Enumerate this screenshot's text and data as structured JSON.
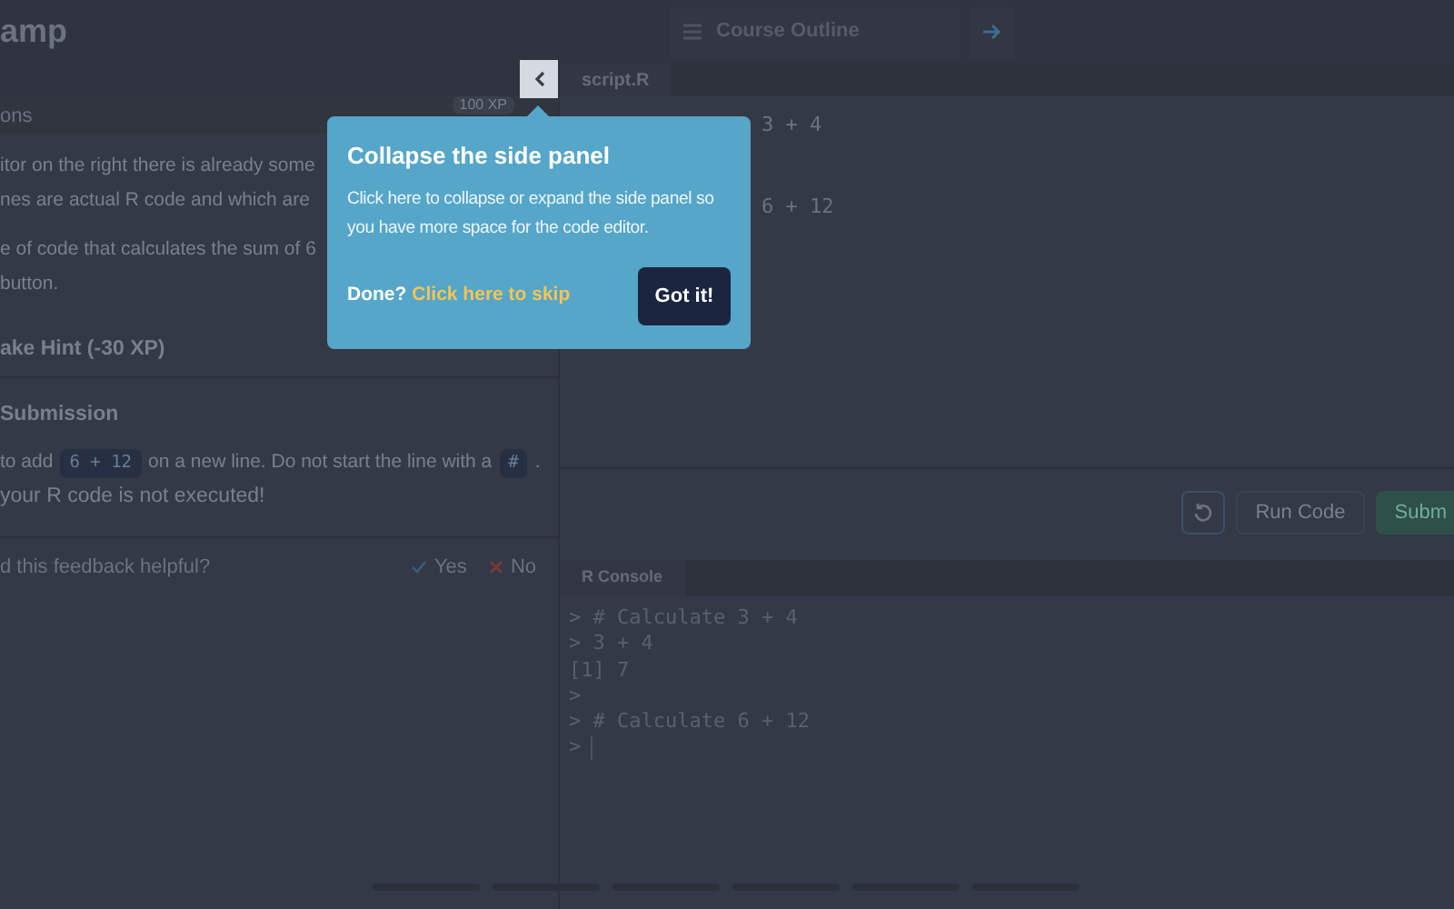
{
  "header": {
    "title": "amp",
    "course_outline": "Course Outline"
  },
  "exercise": {
    "tab": "ons",
    "xp": "100 XP",
    "paragraphs": [
      [
        "itor on the right there is already some",
        "nes are actual R code and which are"
      ],
      [
        "e of code that calculates the sum of 6",
        "button."
      ]
    ],
    "hint": "ake Hint (-30 XP)",
    "feedback": {
      "title": "Submission",
      "segments": [
        {
          "kind": "text",
          "text": "to add"
        },
        {
          "kind": "code",
          "text": "6 + 12"
        },
        {
          "kind": "text",
          "text": "on a new line. Do not start the line with a"
        },
        {
          "kind": "code",
          "text": "#"
        },
        {
          "kind": "text",
          "text": "."
        }
      ],
      "last_line": "your R code is not executed!"
    },
    "helpful": {
      "question": "d this feedback helpful?",
      "yes": "Yes",
      "no": "No"
    }
  },
  "editor": {
    "tab": "script.R",
    "lines": [
      "3 + 4",
      "6 + 12"
    ],
    "run": "Run Code",
    "submit": "Subm"
  },
  "console": {
    "tab": "R Console",
    "lines": [
      "> # Calculate 3 + 4",
      "> 3 + 4",
      "[1] 7",
      ">",
      "> # Calculate 6 + 12",
      ">"
    ]
  },
  "popup": {
    "title": "Collapse the side panel",
    "body": "Click here to collapse or expand the side panel so you have more space for the code editor.",
    "done": "Done?",
    "skip": "Click here to skip",
    "button": "Got it!"
  }
}
